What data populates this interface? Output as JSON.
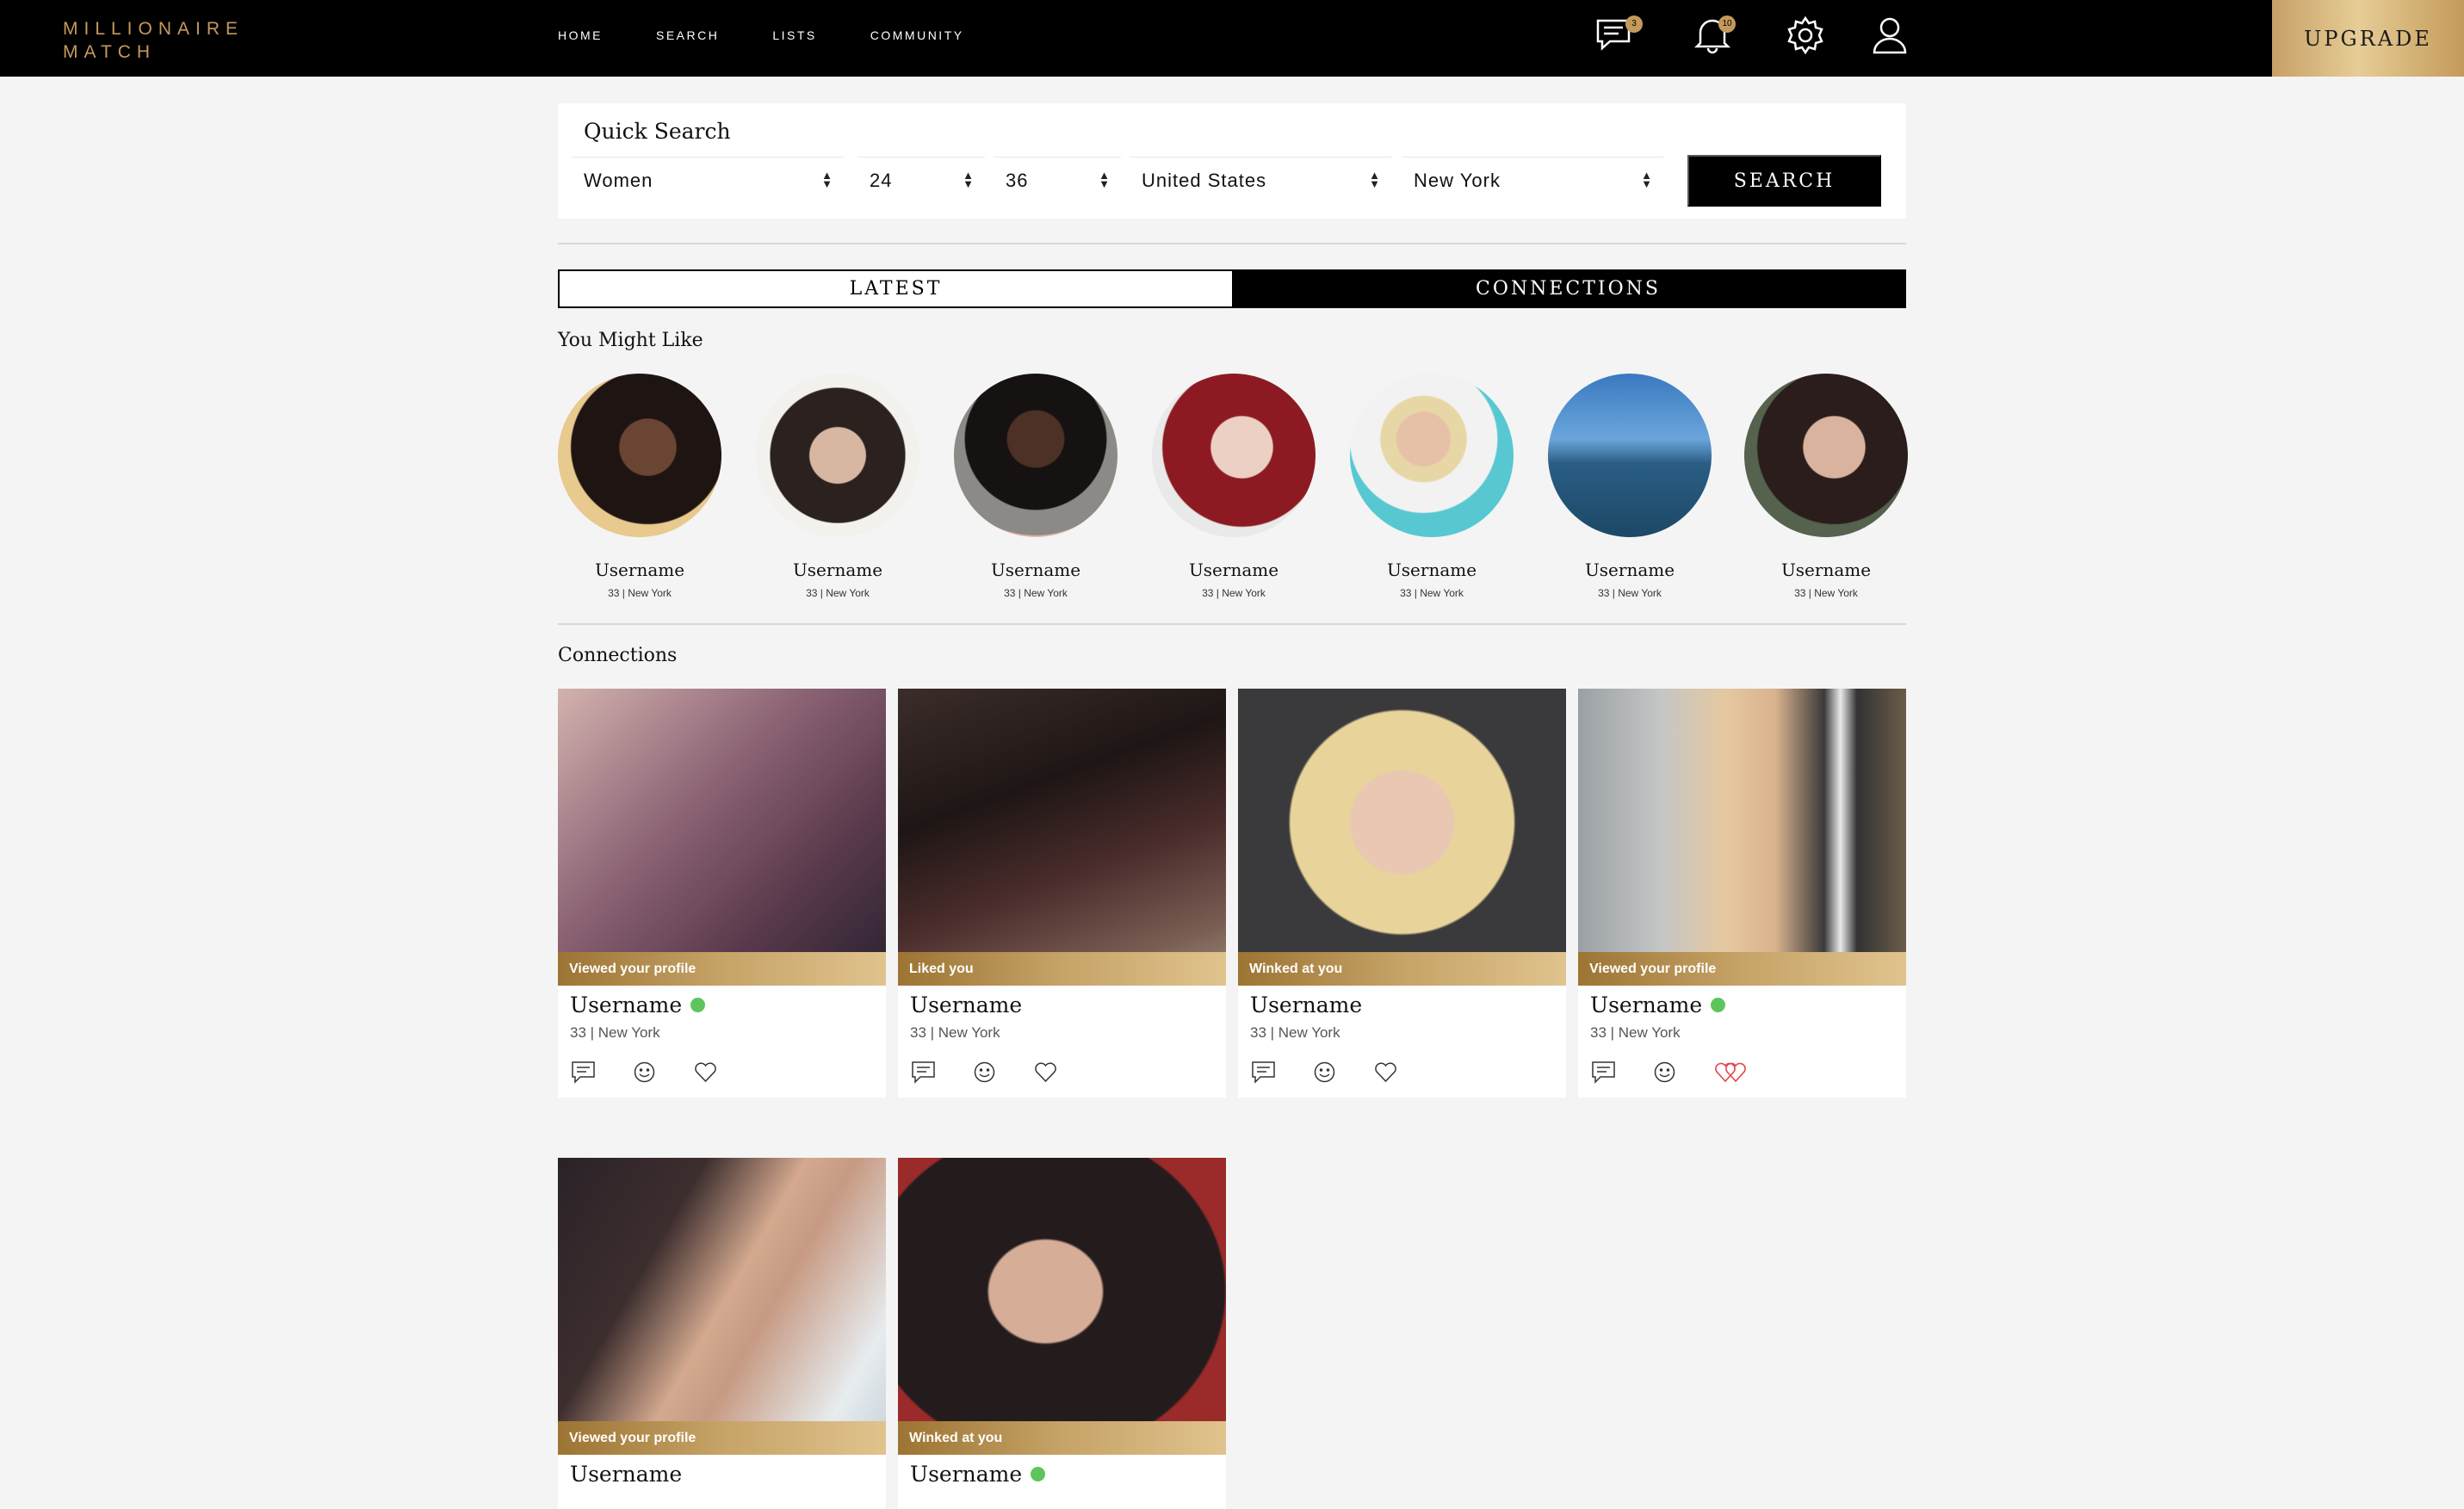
{
  "brand": {
    "line1": "MILLIONAIRE",
    "line2": "MATCH"
  },
  "nav": {
    "items": [
      "HOME",
      "SEARCH",
      "LISTS",
      "COMMUNITY"
    ]
  },
  "header_icons": {
    "messages_badge": "3",
    "notifications_badge": "10"
  },
  "upgrade_label": "UPGRADE",
  "quick_search": {
    "title": "Quick Search",
    "gender": "Women",
    "age_min": "24",
    "age_max": "36",
    "country": "United States",
    "city": "New York",
    "button": "SEARCH"
  },
  "tabs": {
    "latest": "LATEST",
    "connections": "CONNECTIONS",
    "active": "connections"
  },
  "suggestions": {
    "title": "You Might Like",
    "items": [
      {
        "name": "Username",
        "meta": "33 | New York"
      },
      {
        "name": "Username",
        "meta": "33 | New York"
      },
      {
        "name": "Username",
        "meta": "33 | New York"
      },
      {
        "name": "Username",
        "meta": "33 | New York"
      },
      {
        "name": "Username",
        "meta": "33 | New York"
      },
      {
        "name": "Username",
        "meta": "33 | New York"
      },
      {
        "name": "Username",
        "meta": "33 | New York"
      }
    ]
  },
  "connections": {
    "title": "Connections",
    "cards": [
      {
        "status": "Viewed your profile",
        "name": "Username",
        "meta": "33 | New York",
        "online": true,
        "liked": false
      },
      {
        "status": "Liked you",
        "name": "Username",
        "meta": "33 | New York",
        "online": false,
        "liked": false
      },
      {
        "status": "Winked at you",
        "name": "Username",
        "meta": "33 | New York",
        "online": false,
        "liked": false
      },
      {
        "status": "Viewed your profile",
        "name": "Username",
        "meta": "33 | New York",
        "online": true,
        "liked": true
      },
      {
        "status": "Viewed your profile",
        "name": "Username",
        "meta": "",
        "online": false,
        "liked": false
      },
      {
        "status": "Winked at you",
        "name": "Username",
        "meta": "",
        "online": true,
        "liked": false
      }
    ]
  },
  "colors": {
    "gold": "#c49a5a",
    "online": "#5ec55e",
    "liked": "#e0464e"
  }
}
